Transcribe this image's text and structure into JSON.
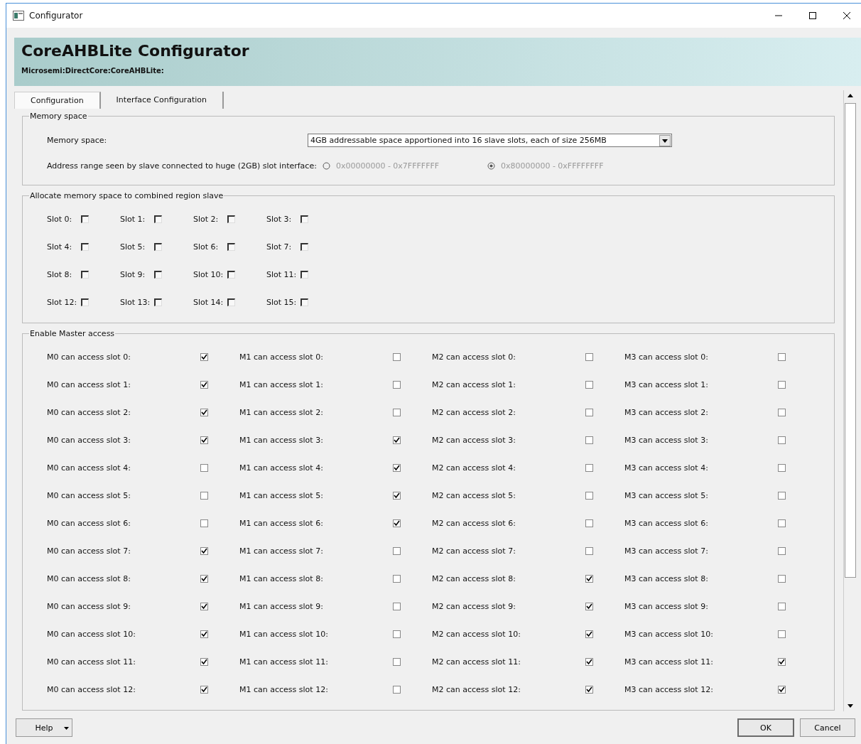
{
  "window": {
    "title": "Configurator"
  },
  "header": {
    "title": "CoreAHBLite Configurator",
    "subtitle": "Microsemi:DirectCore:CoreAHBLite:"
  },
  "tabs": [
    {
      "label": "Configuration",
      "selected": true
    },
    {
      "label": "Interface Configuration",
      "selected": false
    }
  ],
  "memory_space": {
    "title": "Memory space",
    "label": "Memory space:",
    "value": "4GB addressable space apportioned into 16 slave slots, each of size 256MB",
    "address_label": "Address range seen by slave connected to huge (2GB) slot interface:",
    "address_options": [
      {
        "label": "0x00000000 - 0x7FFFFFFF",
        "selected": false,
        "disabled": true
      },
      {
        "label": "0x80000000 - 0xFFFFFFFF",
        "selected": true,
        "disabled": true
      }
    ]
  },
  "combined_region": {
    "title": "Allocate memory space to combined region slave",
    "slots": [
      {
        "label": "Slot 0:",
        "checked": false
      },
      {
        "label": "Slot 1:",
        "checked": false
      },
      {
        "label": "Slot 2:",
        "checked": false
      },
      {
        "label": "Slot 3:",
        "checked": false
      },
      {
        "label": "Slot 4:",
        "checked": false
      },
      {
        "label": "Slot 5:",
        "checked": false
      },
      {
        "label": "Slot 6:",
        "checked": false
      },
      {
        "label": "Slot 7:",
        "checked": false
      },
      {
        "label": "Slot 8:",
        "checked": false
      },
      {
        "label": "Slot 9:",
        "checked": false
      },
      {
        "label": "Slot 10:",
        "checked": false
      },
      {
        "label": "Slot 11:",
        "checked": false
      },
      {
        "label": "Slot 12:",
        "checked": false
      },
      {
        "label": "Slot 13:",
        "checked": false
      },
      {
        "label": "Slot 14:",
        "checked": false
      },
      {
        "label": "Slot 15:",
        "checked": false
      }
    ]
  },
  "master_access": {
    "title": "Enable Master access",
    "rows": [
      [
        {
          "label": "M0 can access slot 0:",
          "checked": true
        },
        {
          "label": "M1 can access slot 0:",
          "checked": false
        },
        {
          "label": "M2 can access slot 0:",
          "checked": false
        },
        {
          "label": "M3 can access slot 0:",
          "checked": false
        }
      ],
      [
        {
          "label": "M0 can access slot 1:",
          "checked": true
        },
        {
          "label": "M1 can access slot 1:",
          "checked": false
        },
        {
          "label": "M2 can access slot 1:",
          "checked": false
        },
        {
          "label": "M3 can access slot 1:",
          "checked": false
        }
      ],
      [
        {
          "label": "M0 can access slot 2:",
          "checked": true
        },
        {
          "label": "M1 can access slot 2:",
          "checked": false
        },
        {
          "label": "M2 can access slot 2:",
          "checked": false
        },
        {
          "label": "M3 can access slot 2:",
          "checked": false
        }
      ],
      [
        {
          "label": "M0 can access slot 3:",
          "checked": true
        },
        {
          "label": "M1 can access slot 3:",
          "checked": true
        },
        {
          "label": "M2 can access slot 3:",
          "checked": false
        },
        {
          "label": "M3 can access slot 3:",
          "checked": false
        }
      ],
      [
        {
          "label": "M0 can access slot 4:",
          "checked": false
        },
        {
          "label": "M1 can access slot 4:",
          "checked": true
        },
        {
          "label": "M2 can access slot 4:",
          "checked": false
        },
        {
          "label": "M3 can access slot 4:",
          "checked": false
        }
      ],
      [
        {
          "label": "M0 can access slot 5:",
          "checked": false
        },
        {
          "label": "M1 can access slot 5:",
          "checked": true
        },
        {
          "label": "M2 can access slot 5:",
          "checked": false
        },
        {
          "label": "M3 can access slot 5:",
          "checked": false
        }
      ],
      [
        {
          "label": "M0 can access slot 6:",
          "checked": false
        },
        {
          "label": "M1 can access slot 6:",
          "checked": true
        },
        {
          "label": "M2 can access slot 6:",
          "checked": false
        },
        {
          "label": "M3 can access slot 6:",
          "checked": false
        }
      ],
      [
        {
          "label": "M0 can access slot 7:",
          "checked": true
        },
        {
          "label": "M1 can access slot 7:",
          "checked": false
        },
        {
          "label": "M2 can access slot 7:",
          "checked": false
        },
        {
          "label": "M3 can access slot 7:",
          "checked": false
        }
      ],
      [
        {
          "label": "M0 can access slot 8:",
          "checked": true
        },
        {
          "label": "M1 can access slot 8:",
          "checked": false
        },
        {
          "label": "M2 can access slot 8:",
          "checked": true
        },
        {
          "label": "M3 can access slot 8:",
          "checked": false
        }
      ],
      [
        {
          "label": "M0 can access slot 9:",
          "checked": true
        },
        {
          "label": "M1 can access slot 9:",
          "checked": false
        },
        {
          "label": "M2 can access slot 9:",
          "checked": true
        },
        {
          "label": "M3 can access slot 9:",
          "checked": false
        }
      ],
      [
        {
          "label": "M0 can access slot 10:",
          "checked": true
        },
        {
          "label": "M1 can access slot 10:",
          "checked": false
        },
        {
          "label": "M2 can access slot 10:",
          "checked": true
        },
        {
          "label": "M3 can access slot 10:",
          "checked": false
        }
      ],
      [
        {
          "label": "M0 can access slot 11:",
          "checked": true
        },
        {
          "label": "M1 can access slot 11:",
          "checked": false
        },
        {
          "label": "M2 can access slot 11:",
          "checked": true
        },
        {
          "label": "M3 can access slot 11:",
          "checked": true
        }
      ],
      [
        {
          "label": "M0 can access slot 12:",
          "checked": true
        },
        {
          "label": "M1 can access slot 12:",
          "checked": false
        },
        {
          "label": "M2 can access slot 12:",
          "checked": true
        },
        {
          "label": "M3 can access slot 12:",
          "checked": true
        }
      ]
    ]
  },
  "buttons": {
    "help": "Help",
    "ok": "OK",
    "cancel": "Cancel"
  }
}
